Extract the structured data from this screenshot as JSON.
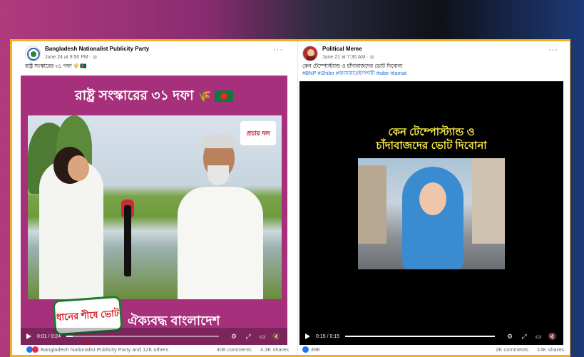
{
  "left_post": {
    "page_name": "Bangladesh Nationalist Publicity Party",
    "date": "June 24 at 9:50 PM · ",
    "more": "···",
    "caption": "রাষ্ট্র সংস্কারের ৩১ দফা 🌾🇧🇩",
    "video": {
      "banner": "রাষ্ট্র সংস্কারের ৩১ দফা",
      "badge": "প্রচার দল",
      "sticker": "ধানের শীষে ভোট দিন",
      "bottom_text": "ঐক্যবদ্ধ বাংলাদেশ",
      "time": "0:01 / 0:24",
      "progress": 0.04
    },
    "reactions_text": "Bangladesh Nationalist Publicity Party and 12K others",
    "comments": "408 comments",
    "shares": "4.3K shares"
  },
  "right_post": {
    "page_name": "Political Meme",
    "date": "June 21 at 7:30 AM · ",
    "more": "···",
    "caption": "কেন টেম্পোস্ট্যান্ড ও চাঁদাবাজদের ভোট দিবোনা",
    "hashtags": "#BNP #Shibir #জামায়াতইসলামী #sibir #jamat",
    "video": {
      "headline_line1": "কেন টেম্পোস্ট্যান্ড ও",
      "headline_line2": "চাঁদাবাজদের ভোট দিবোনা",
      "time": "0:15 / 0:15",
      "progress": 1.0
    },
    "reactions_count": "49K",
    "comments": "2K comments",
    "shares": "14K shares"
  },
  "colors": {
    "frame": "#f2b21c",
    "left_video_bg": "#a6307b",
    "headline": "#f7e94a",
    "link": "#1f6fd1"
  },
  "icons": [
    "play-icon",
    "settings-icon",
    "expand-icon",
    "pip-icon",
    "mute-icon",
    "globe-icon"
  ]
}
